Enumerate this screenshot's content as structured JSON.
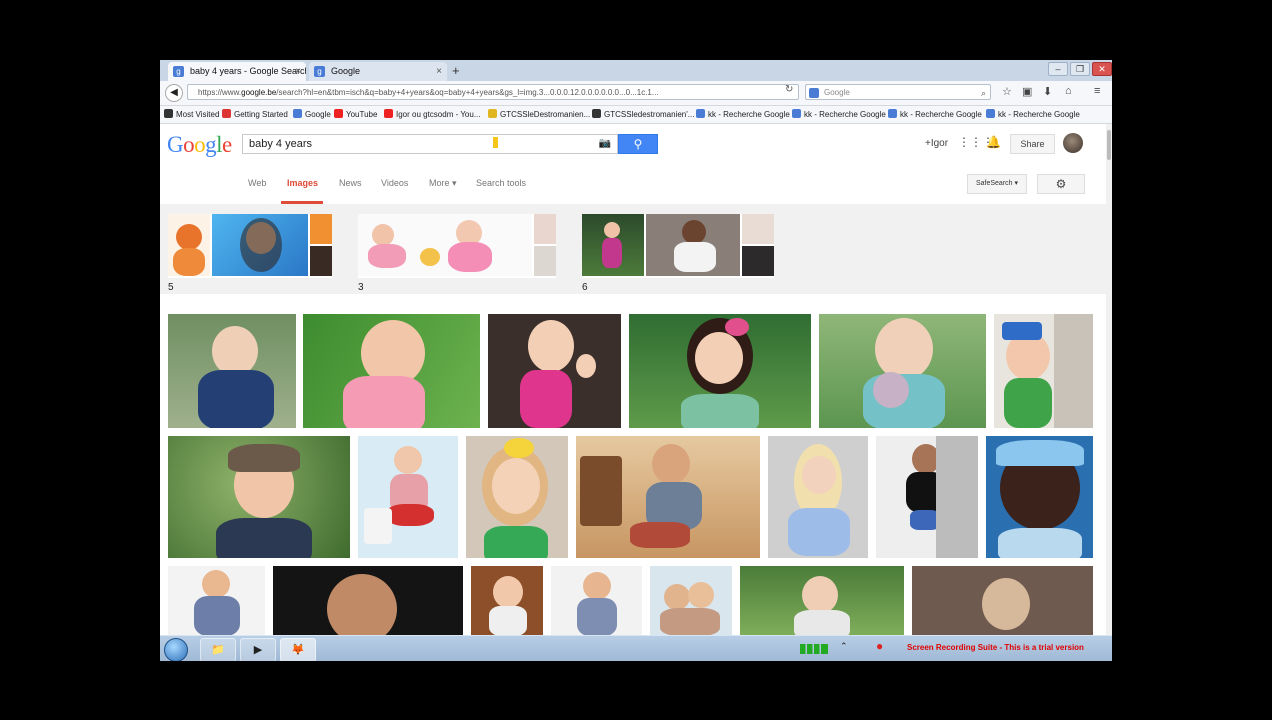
{
  "browser": {
    "tabs": [
      {
        "label": "baby 4 years - Google Search",
        "active": true
      },
      {
        "label": "Google",
        "active": false
      }
    ],
    "url_prefix": "https://www.",
    "url_domain": "google.be",
    "url_rest": "/search?hl=en&tbm=isch&q=baby+4+years&oq=baby+4+years&gs_l=img.3...0.0.0.12.0.0.0.0.0.0...0...1c.1...",
    "search_placeholder": "Google",
    "bookmarks": [
      {
        "label": "Most Visited"
      },
      {
        "label": "Getting Started"
      },
      {
        "label": "Google"
      },
      {
        "label": "YouTube"
      },
      {
        "label": "Igor ou gtcsodm - You..."
      },
      {
        "label": "GTCSSleDestromanien..."
      },
      {
        "label": "GTCSSledestromanien'..."
      },
      {
        "label": "kk - Recherche Google"
      },
      {
        "label": "kk - Recherche Google"
      },
      {
        "label": "kk - Recherche Google"
      },
      {
        "label": "kk - Recherche Google"
      }
    ]
  },
  "google": {
    "logo": "Google",
    "query": "baby 4 years",
    "user": "+Igor",
    "share": "Share",
    "tabs": [
      "Web",
      "Images",
      "News",
      "Videos",
      "More ▾",
      "Search tools"
    ],
    "safe_search": "SafeSearch ▾",
    "related_counts": [
      "5",
      "3",
      "6"
    ]
  },
  "taskbar": {
    "trial_text": "Screen Recording Suite - This is a trial version"
  },
  "icons": {
    "back": "back-arrow-icon",
    "camera": "camera-icon",
    "search": "magnifier-icon",
    "apps": "apps-grid-icon",
    "bell": "bell-icon",
    "gear": "gear-icon"
  }
}
